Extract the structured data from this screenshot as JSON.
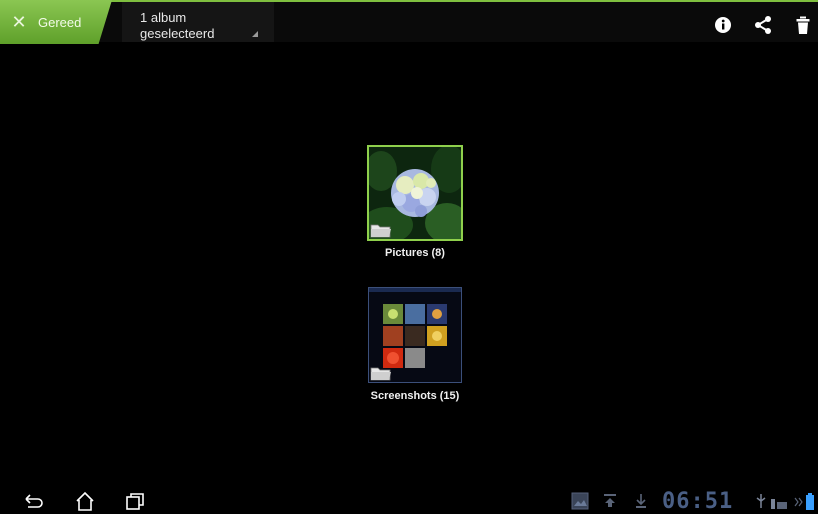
{
  "actionbar": {
    "done_label": "Gereed",
    "selection_line1": "1 album",
    "selection_line2": "geselecteerd",
    "icons": [
      "close-icon",
      "info-icon",
      "share-icon",
      "trash-icon"
    ]
  },
  "albums": [
    {
      "label": "Pictures (8)",
      "selected": true
    },
    {
      "label": "Screenshots (15)",
      "selected": false
    }
  ],
  "statusbar": {
    "clock": "06:51",
    "icons": [
      "gallery-notification-icon",
      "upload-icon",
      "download-icon",
      "usb-icon",
      "signal-icon",
      "battery-icon"
    ]
  },
  "navbar": {
    "icons": [
      "back-icon",
      "home-icon",
      "recent-apps-icon"
    ]
  },
  "colors": {
    "accent": "#7fbf3f",
    "background": "#000000",
    "clock": "#4a5f85"
  }
}
